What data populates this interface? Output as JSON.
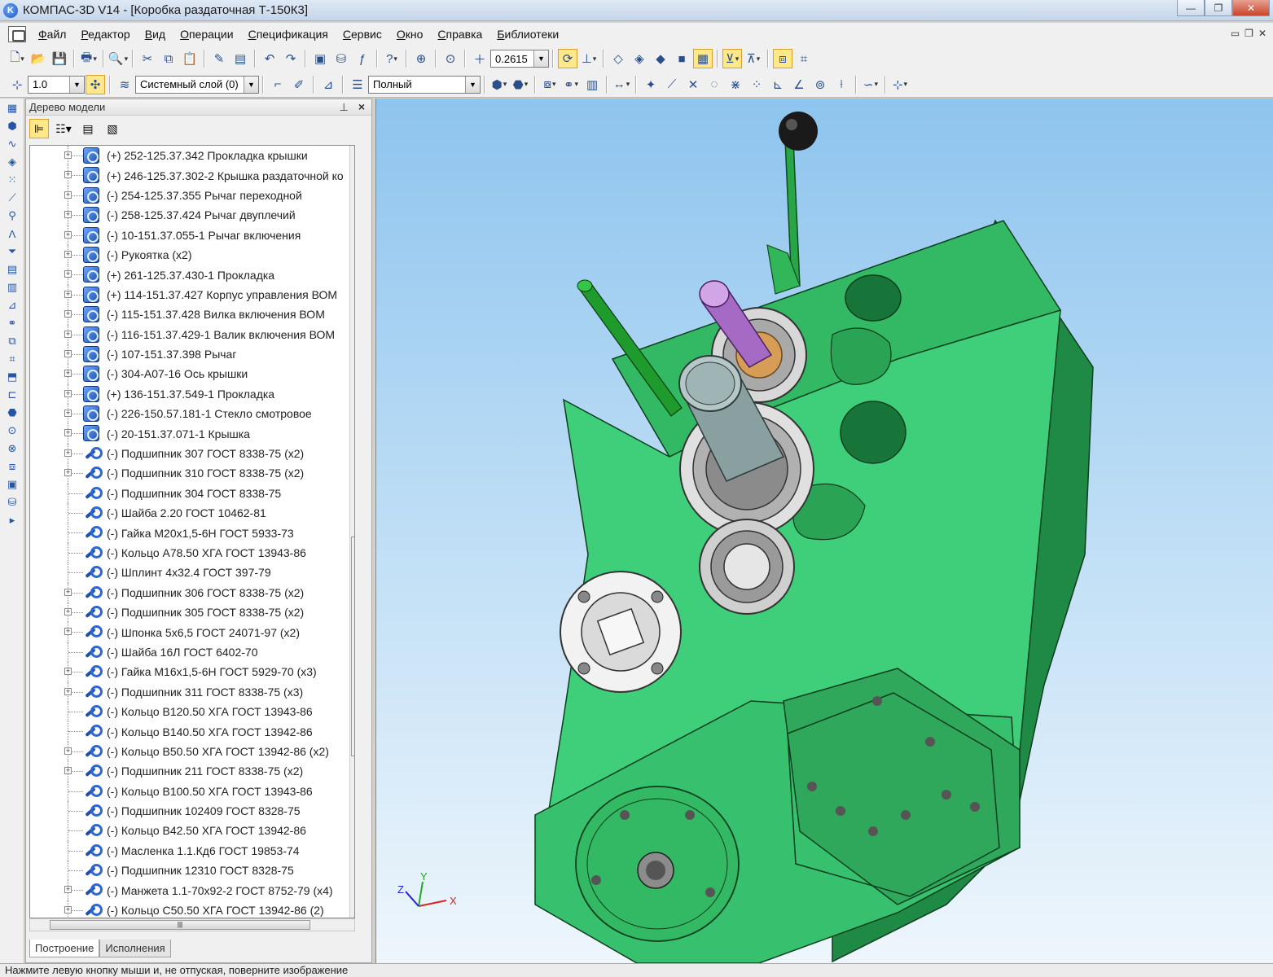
{
  "window": {
    "title": "КОМПАС-3D V14 - [Коробка раздаточная Т-150К3]",
    "logo": "K"
  },
  "menu": [
    "Файл",
    "Редактор",
    "Вид",
    "Операции",
    "Спецификация",
    "Сервис",
    "Окно",
    "Справка",
    "Библиотеки"
  ],
  "toolbar": {
    "zoom_value": "0.2615",
    "step_value": "1.0",
    "layer_value": "Системный слой (0)",
    "view_mode_value": "Полный"
  },
  "model_tree": {
    "title": "Дерево модели",
    "items": [
      {
        "label": "(+) 252-125.37.342 Прокладка крышки",
        "type": "assembly",
        "expandable": true
      },
      {
        "label": "(+) 246-125.37.302-2 Крышка раздаточной ко",
        "type": "assembly",
        "expandable": true
      },
      {
        "label": "(-) 254-125.37.355 Рычаг переходной",
        "type": "assembly",
        "expandable": true
      },
      {
        "label": "(-) 258-125.37.424 Рычаг двуплечий",
        "type": "assembly",
        "expandable": true
      },
      {
        "label": "(-) 10-151.37.055-1 Рычаг включения",
        "type": "assembly",
        "expandable": true
      },
      {
        "label": "(-) Рукоятка (x2)",
        "type": "assembly",
        "expandable": true
      },
      {
        "label": "(+) 261-125.37.430-1 Прокладка",
        "type": "assembly",
        "expandable": true
      },
      {
        "label": "(+) 114-151.37.427 Корпус управления ВОМ",
        "type": "assembly",
        "expandable": true
      },
      {
        "label": "(-) 115-151.37.428 Вилка включения ВОМ",
        "type": "assembly",
        "expandable": true
      },
      {
        "label": "(-) 116-151.37.429-1 Валик включения ВОМ",
        "type": "assembly",
        "expandable": true
      },
      {
        "label": "(-) 107-151.37.398 Рычаг",
        "type": "assembly",
        "expandable": true
      },
      {
        "label": "(-) 304-А07-16 Ось крышки",
        "type": "assembly",
        "expandable": true
      },
      {
        "label": "(+) 136-151.37.549-1 Прокладка",
        "type": "assembly",
        "expandable": true
      },
      {
        "label": "(-) 226-150.57.181-1 Стекло смотровое",
        "type": "assembly",
        "expandable": true
      },
      {
        "label": "(-) 20-151.37.071-1 Крышка",
        "type": "assembly",
        "expandable": true
      },
      {
        "label": "(-) Подшипник 307 ГОСТ 8338-75 (x2)",
        "type": "standard",
        "expandable": true
      },
      {
        "label": "(-) Подшипник 310 ГОСТ 8338-75 (x2)",
        "type": "standard",
        "expandable": true
      },
      {
        "label": "(-) Подшипник 304 ГОСТ 8338-75",
        "type": "standard",
        "expandable": false
      },
      {
        "label": "(-) Шайба 2.20 ГОСТ 10462-81",
        "type": "standard",
        "expandable": false
      },
      {
        "label": "(-) Гайка М20х1,5-6Н ГОСТ 5933-73",
        "type": "standard",
        "expandable": false
      },
      {
        "label": "(-) Кольцо А78.50 ХГА ГОСТ 13943-86",
        "type": "standard",
        "expandable": false
      },
      {
        "label": "(-) Шплинт 4х32.4 ГОСТ 397-79",
        "type": "standard",
        "expandable": false
      },
      {
        "label": "(-) Подшипник 306 ГОСТ 8338-75 (x2)",
        "type": "standard",
        "expandable": true
      },
      {
        "label": "(-) Подшипник 305 ГОСТ 8338-75 (x2)",
        "type": "standard",
        "expandable": true
      },
      {
        "label": "(-) Шпонка 5х6,5 ГОСТ 24071-97 (x2)",
        "type": "standard",
        "expandable": true
      },
      {
        "label": "(-) Шайба 16Л ГОСТ 6402-70",
        "type": "standard",
        "expandable": false
      },
      {
        "label": "(-) Гайка М16х1,5-6Н ГОСТ 5929-70 (x3)",
        "type": "standard",
        "expandable": true
      },
      {
        "label": "(-) Подшипник 311 ГОСТ 8338-75 (x3)",
        "type": "standard",
        "expandable": true
      },
      {
        "label": "(-) Кольцо В120.50 ХГА ГОСТ 13943-86",
        "type": "standard",
        "expandable": false
      },
      {
        "label": "(-) Кольцо В140.50 ХГА ГОСТ 13942-86",
        "type": "standard",
        "expandable": false
      },
      {
        "label": "(-) Кольцо В50.50 ХГА ГОСТ 13942-86 (x2)",
        "type": "standard",
        "expandable": true
      },
      {
        "label": "(-) Подшипник 211 ГОСТ 8338-75 (x2)",
        "type": "standard",
        "expandable": true
      },
      {
        "label": "(-) Кольцо В100.50 ХГА ГОСТ 13943-86",
        "type": "standard",
        "expandable": false
      },
      {
        "label": "(-) Подшипник 102409 ГОСТ 8328-75",
        "type": "standard",
        "expandable": false
      },
      {
        "label": "(-) Кольцо В42.50 ХГА ГОСТ 13942-86",
        "type": "standard",
        "expandable": false
      },
      {
        "label": "(-) Масленка 1.1.Кд6 ГОСТ 19853-74",
        "type": "standard",
        "expandable": false
      },
      {
        "label": "(-) Подшипник 12310 ГОСТ 8328-75",
        "type": "standard",
        "expandable": false
      },
      {
        "label": "(-) Манжета 1.1-70х92-2 ГОСТ 8752-79 (x4)",
        "type": "standard",
        "expandable": true
      },
      {
        "label": "(-) Кольцо С50.50 ХГА ГОСТ 13942-86 (2)",
        "type": "standard",
        "expandable": true
      }
    ],
    "tabs": [
      "Построение",
      "Исполнения"
    ]
  },
  "axes": {
    "x": "X",
    "y": "Y",
    "z": "Z"
  },
  "colors": {
    "body": "#3fcf7a",
    "body_dark": "#1f8a45",
    "shaft": "#c08ad8",
    "lever": "#2a9a2a"
  },
  "status": "Нажмите левую кнопку мыши и, не отпуская, поверните изображение"
}
